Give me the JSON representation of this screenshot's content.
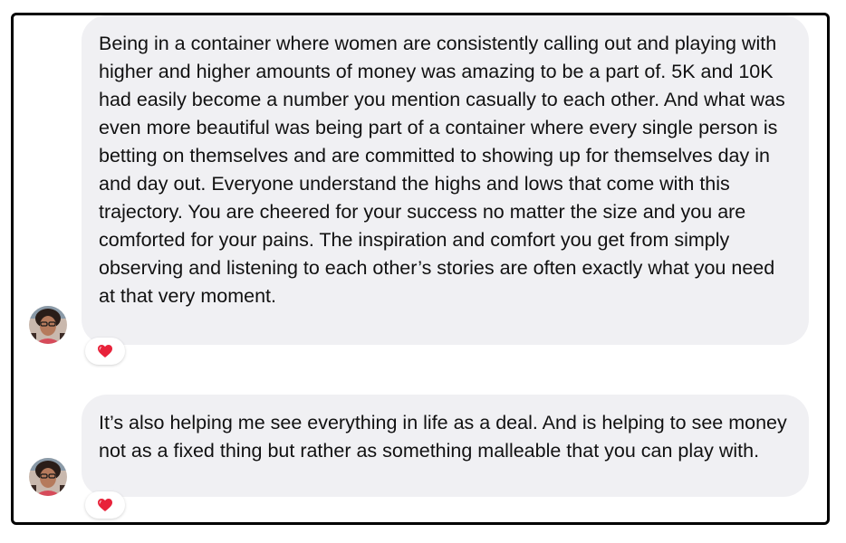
{
  "messages": [
    {
      "text": "Being in a container where women are consistently calling out and playing with higher and higher amounts of money was amazing to be a part of. 5K and 10K had easily become a number you mention casually to each other. And what was even more beautiful was being part of a container where every single person is betting on themselves and are committed to showing up for themselves day in and day out. Everyone understand the highs and lows that come with this trajectory. You are cheered for your success no matter the size and you are comforted for your pains. The inspiration and comfort you get from simply observing and listening to each other’s stories are often exactly what you need at that very moment.",
      "reaction_icon": "heart-icon"
    },
    {
      "text": "It’s also helping me see everything in life as a deal. And is helping to see money not as a fixed thing but rather as something malleable that you can play with.",
      "reaction_icon": "heart-icon"
    }
  ],
  "colors": {
    "bubble": "#f0f0f3",
    "heart": "#e8223a",
    "frame_border": "#000000"
  }
}
